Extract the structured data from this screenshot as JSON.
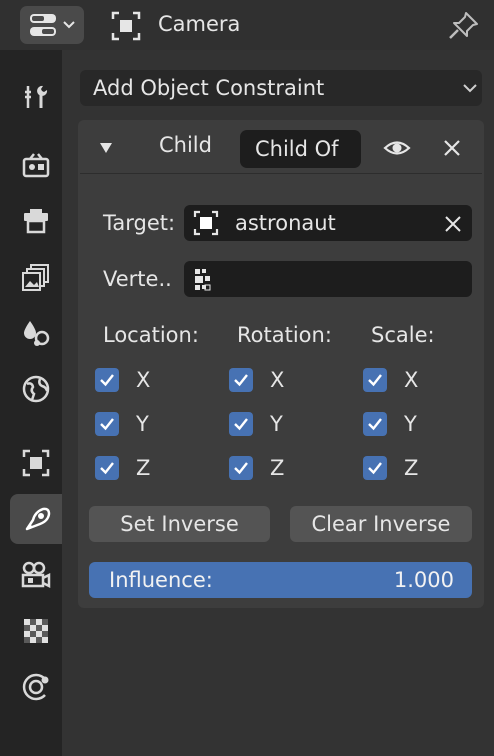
{
  "header": {
    "object_name": "Camera"
  },
  "sidebar": {
    "tabs": [
      {
        "icon": "tool-icon"
      },
      {
        "icon": "render-icon"
      },
      {
        "icon": "output-icon"
      },
      {
        "icon": "view-layer-icon"
      },
      {
        "icon": "scene-icon"
      },
      {
        "icon": "world-icon"
      },
      {
        "icon": "object-icon"
      },
      {
        "icon": "constraint-icon",
        "active": true
      },
      {
        "icon": "camera-data-icon"
      },
      {
        "icon": "texture-icon"
      },
      {
        "icon": "physics-icon"
      }
    ]
  },
  "main": {
    "add_constraint_label": "Add Object Constraint",
    "constraint": {
      "name": "Child",
      "type": "Child Of",
      "target_label": "Target:",
      "target_value": "astronaut",
      "vertex_label": "Verte..",
      "groups": {
        "location": {
          "label": "Location:",
          "x": "X",
          "y": "Y",
          "z": "Z"
        },
        "rotation": {
          "label": "Rotation:",
          "x": "X",
          "y": "Y",
          "z": "Z"
        },
        "scale": {
          "label": "Scale:",
          "x": "X",
          "y": "Y",
          "z": "Z"
        }
      },
      "set_inverse_label": "Set Inverse",
      "clear_inverse_label": "Clear Inverse",
      "influence_label": "Influence:",
      "influence_value": "1.000"
    }
  },
  "colors": {
    "accent": "#4772b3",
    "panel": "#3d3d3d",
    "field": "#1d1d1d"
  }
}
